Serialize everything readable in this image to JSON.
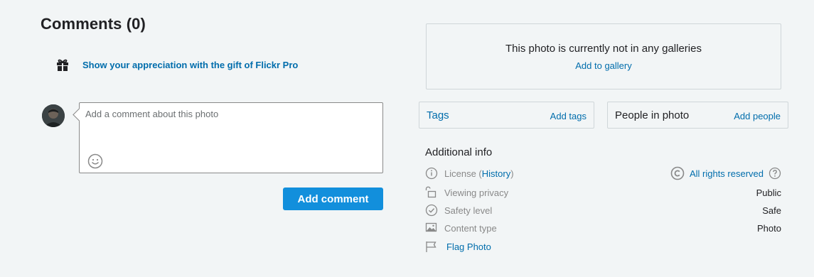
{
  "comments": {
    "title": "Comments (0)",
    "gift_link": "Show your appreciation with the gift of Flickr Pro",
    "input_placeholder": "Add a comment about this photo",
    "input_value": "",
    "add_button": "Add comment"
  },
  "galleries": {
    "text": "This photo is currently not in any galleries",
    "add_link": "Add to gallery"
  },
  "tags": {
    "title": "Tags",
    "add_link": "Add tags"
  },
  "people": {
    "title": "People in photo",
    "add_link": "Add people"
  },
  "additional_info": {
    "title": "Additional info",
    "license": {
      "label": "License (",
      "history_link": "History",
      "label_close": ")",
      "value": "All rights reserved",
      "icon": "copyright-icon"
    },
    "viewing_privacy": {
      "label": "Viewing privacy",
      "value": "Public",
      "icon": "lock-open-icon"
    },
    "safety_level": {
      "label": "Safety level",
      "value": "Safe",
      "icon": "check-circle-icon"
    },
    "content_type": {
      "label": "Content type",
      "value": "Photo",
      "icon": "image-icon"
    },
    "flag": {
      "label": "Flag Photo",
      "icon": "flag-icon"
    }
  },
  "colors": {
    "background": "#f2f5f6",
    "link": "#006dac",
    "primary_button": "#128fdc",
    "muted_text": "#898989",
    "border": "#cfd6d9"
  }
}
